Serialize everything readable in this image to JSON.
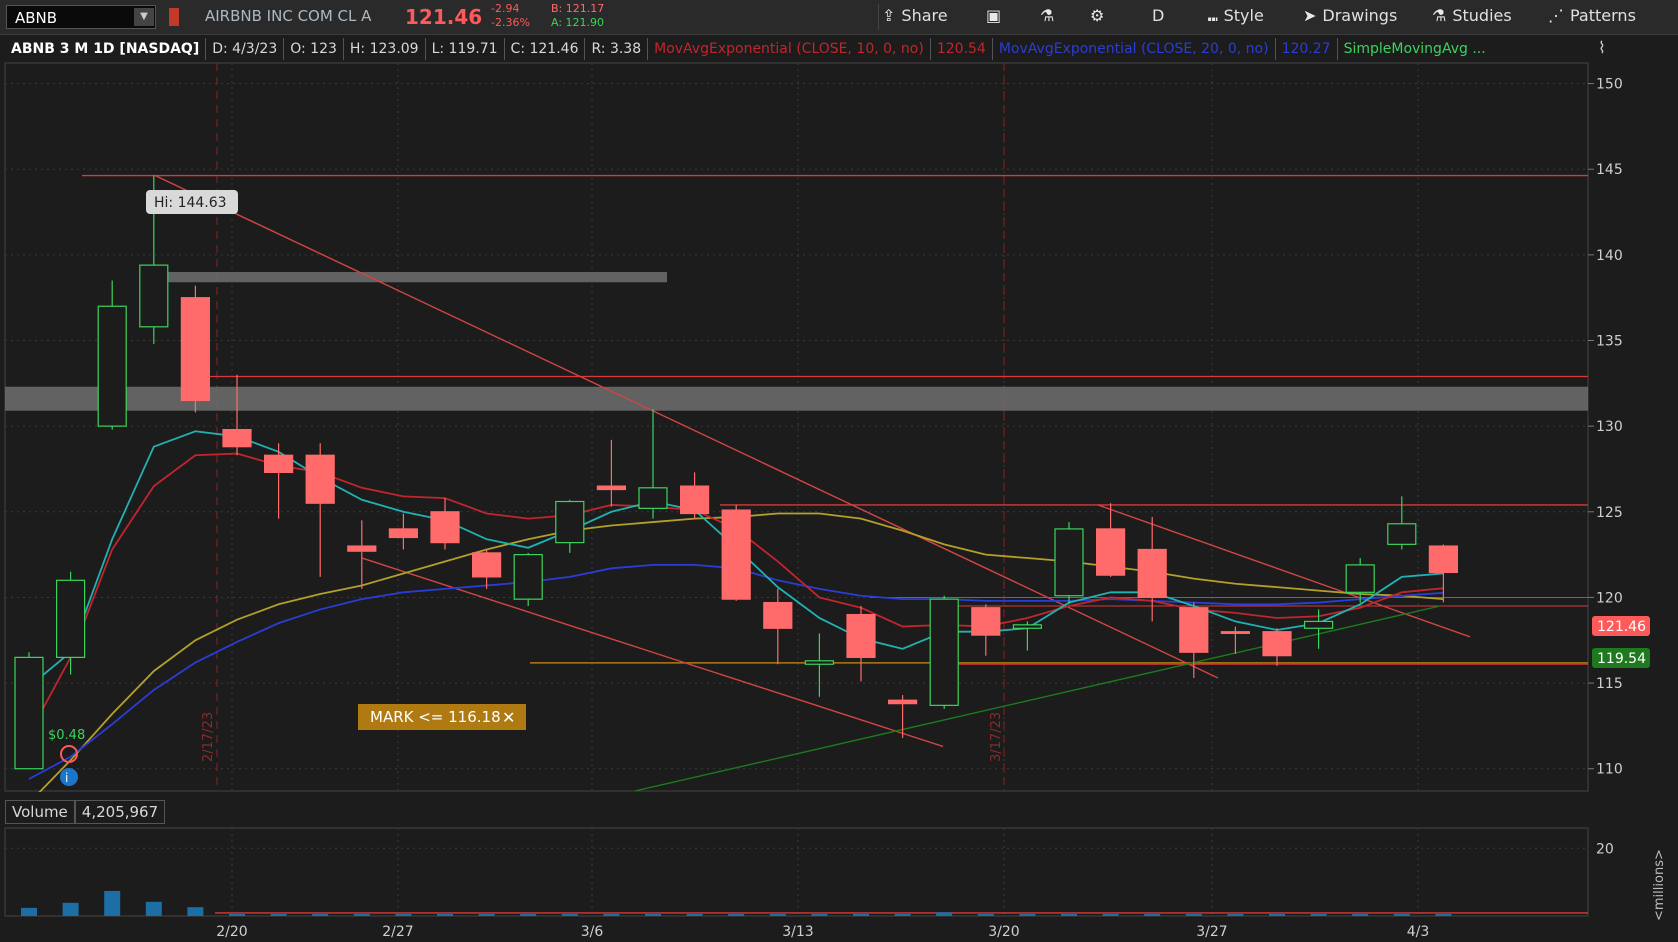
{
  "toolbar": {
    "symbol": "ABNB",
    "company": "AIRBNB INC COM CL A",
    "last": "121.46",
    "change": "-2.94",
    "change_pct": "-2.36%",
    "bid": "B: 121.17",
    "ask": "A: 121.90",
    "share": "Share",
    "timeframe": "D",
    "style": "Style",
    "drawings": "Drawings",
    "studies": "Studies",
    "patterns": "Patterns"
  },
  "status": {
    "title": "ABNB 3 M 1D [NASDAQ]",
    "date": "D: 4/3/23",
    "open": "O: 123",
    "high": "H: 123.09",
    "low": "L: 119.71",
    "close": "C: 121.46",
    "range": "R: 3.38",
    "ema10": "MovAvgExponential (CLOSE, 10, 0, no)",
    "ema10_val": "120.54",
    "ema20": "MovAvgExponential (CLOSE, 20, 0, no)",
    "ema20_val": "120.27",
    "sma": "SimpleMovingAvg ..."
  },
  "volume_panel": {
    "label": "Volume",
    "value": "4,205,967",
    "units": "<millions>"
  },
  "colors": {
    "up": "#3cd35c",
    "down": "#ff6b6b",
    "ema10": "#c0262c",
    "ema20": "#2a3dd6",
    "sma_yellow": "#b3a02a",
    "sma_teal": "#20b2b2",
    "volume": "#1b6fa5",
    "grid": "#3a3a3a"
  },
  "chart_data": {
    "type": "candlestick",
    "x_ticks": [
      "2/20",
      "2/27",
      "3/6",
      "3/13",
      "3/20",
      "3/27",
      "4/3"
    ],
    "y_ticks": [
      110,
      115,
      120,
      125,
      130,
      135,
      140,
      145,
      150
    ],
    "ylim": [
      108.7,
      151.2
    ],
    "candles": [
      {
        "o": 110,
        "h": 116.8,
        "l": 110,
        "c": 116.5
      },
      {
        "o": 116.5,
        "h": 121.5,
        "l": 115.5,
        "c": 121
      },
      {
        "o": 130,
        "h": 138.5,
        "l": 129.8,
        "c": 137
      },
      {
        "o": 135.8,
        "h": 144.63,
        "l": 134.8,
        "c": 139.4
      },
      {
        "o": 137.5,
        "h": 138.2,
        "l": 130.8,
        "c": 131.5
      },
      {
        "o": 129.8,
        "h": 133,
        "l": 128.3,
        "c": 128.8
      },
      {
        "o": 128.3,
        "h": 129,
        "l": 124.6,
        "c": 127.3
      },
      {
        "o": 128.3,
        "h": 129,
        "l": 121.2,
        "c": 125.5
      },
      {
        "o": 123,
        "h": 124.5,
        "l": 120.5,
        "c": 122.7
      },
      {
        "o": 124,
        "h": 124.9,
        "l": 122.8,
        "c": 123.5
      },
      {
        "o": 125,
        "h": 125.8,
        "l": 122.8,
        "c": 123.2
      },
      {
        "o": 122.6,
        "h": 122.8,
        "l": 120.5,
        "c": 121.2
      },
      {
        "o": 119.9,
        "h": 122.6,
        "l": 119.5,
        "c": 122.5
      },
      {
        "o": 123.2,
        "h": 125.7,
        "l": 122.6,
        "c": 125.6
      },
      {
        "o": 126.5,
        "h": 129.2,
        "l": 125.3,
        "c": 126.3
      },
      {
        "o": 125.2,
        "h": 131,
        "l": 124.6,
        "c": 126.4
      },
      {
        "o": 126.5,
        "h": 127.3,
        "l": 124.6,
        "c": 124.9
      },
      {
        "o": 125.1,
        "h": 125.4,
        "l": 119.8,
        "c": 119.9
      },
      {
        "o": 119.7,
        "h": 120.5,
        "l": 116.1,
        "c": 118.2
      },
      {
        "o": 116.1,
        "h": 117.9,
        "l": 114.2,
        "c": 116.3
      },
      {
        "o": 119,
        "h": 119.5,
        "l": 115.1,
        "c": 116.5
      },
      {
        "o": 114,
        "h": 114.3,
        "l": 111.8,
        "c": 113.8
      },
      {
        "o": 113.7,
        "h": 120.1,
        "l": 113.5,
        "c": 119.9
      },
      {
        "o": 119.4,
        "h": 119.6,
        "l": 116.6,
        "c": 117.8
      },
      {
        "o": 118.2,
        "h": 118.6,
        "l": 116.9,
        "c": 118.4
      },
      {
        "o": 120.1,
        "h": 124.4,
        "l": 119.6,
        "c": 124
      },
      {
        "o": 124,
        "h": 125.5,
        "l": 121.2,
        "c": 121.3
      },
      {
        "o": 122.8,
        "h": 124.7,
        "l": 118.6,
        "c": 120
      },
      {
        "o": 119.4,
        "h": 119.7,
        "l": 115.3,
        "c": 116.8
      },
      {
        "o": 118,
        "h": 118.3,
        "l": 116.7,
        "c": 117.9
      },
      {
        "o": 118,
        "h": 118.2,
        "l": 116,
        "c": 116.6
      },
      {
        "o": 118.2,
        "h": 119.3,
        "l": 117,
        "c": 118.6
      },
      {
        "o": 120.3,
        "h": 122.3,
        "l": 119.7,
        "c": 121.9
      },
      {
        "o": 123.1,
        "h": 125.9,
        "l": 122.8,
        "c": 124.3
      },
      {
        "o": 123,
        "h": 123.09,
        "l": 119.71,
        "c": 121.46
      }
    ],
    "volume": [
      2.4,
      3.9,
      7.4,
      4.2,
      2.6,
      0.6,
      0.6,
      0.6,
      0.6,
      0.6,
      0.6,
      0.6,
      0.6,
      0.6,
      0.6,
      0.6,
      0.6,
      0.6,
      0.6,
      0.6,
      0.6,
      0.6,
      1.1,
      0.6,
      0.6,
      0.6,
      0.6,
      0.6,
      0.6,
      0.6,
      0.6,
      0.6,
      0.6,
      0.6,
      0.6
    ],
    "volume_ticks": [
      20
    ],
    "ema10": [
      112,
      116.5,
      122.8,
      126.5,
      128.3,
      128.4,
      127.7,
      127.3,
      126.4,
      125.9,
      125.8,
      124.9,
      124.6,
      124.8,
      125.4,
      125.3,
      125.1,
      124,
      122.1,
      120,
      119.4,
      118.3,
      118.4,
      118.3,
      118.8,
      119.5,
      120,
      119.8,
      119.3,
      119.1,
      118.8,
      118.9,
      119.4,
      120.3,
      120.54
    ],
    "ema20": [
      109.4,
      110.7,
      112.6,
      114.6,
      116.2,
      117.4,
      118.5,
      119.3,
      119.9,
      120.3,
      120.5,
      120.7,
      120.9,
      121.2,
      121.7,
      121.9,
      121.9,
      121.7,
      121,
      120.5,
      120.1,
      119.9,
      119.9,
      119.8,
      119.8,
      119.8,
      119.9,
      119.8,
      119.7,
      119.6,
      119.6,
      119.7,
      119.9,
      120.1,
      120.27
    ],
    "sma_yellow": [
      108,
      110.5,
      113.2,
      115.7,
      117.5,
      118.7,
      119.6,
      120.2,
      120.7,
      121.4,
      122.1,
      122.8,
      123.4,
      123.9,
      124.2,
      124.4,
      124.6,
      124.7,
      124.9,
      124.9,
      124.6,
      123.9,
      123.1,
      122.5,
      122.3,
      122.1,
      121.8,
      121.5,
      121.1,
      120.8,
      120.6,
      120.4,
      120.2,
      120.1,
      119.9
    ],
    "sma_teal": [
      114.8,
      116.8,
      123.4,
      128.8,
      129.7,
      129.4,
      128.5,
      127,
      125.7,
      125,
      124.5,
      123.4,
      122.9,
      123.9,
      125,
      125.6,
      125.1,
      122.9,
      120.6,
      118.8,
      117.6,
      117,
      118,
      118,
      118.2,
      119.7,
      120.3,
      120.3,
      119.5,
      118.6,
      118.1,
      118.5,
      119.6,
      121.2,
      121.4
    ],
    "horizontal_lines": [
      144.63,
      132.9,
      125.4,
      120,
      119.5,
      116.3,
      116.1
    ],
    "shaded_zones": [
      [
        130.9,
        132.3
      ]
    ],
    "markers": {
      "high_label": "Hi: 144.63",
      "mark_label": "MARK <= 116.18",
      "mark_value": 116.18,
      "last_price_label": "121.46",
      "ema_label": "119.54",
      "dividend_label": "$0.48",
      "date_label_1": "2/17/23",
      "date_label_2": "3/17/23"
    }
  }
}
